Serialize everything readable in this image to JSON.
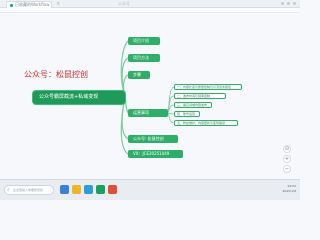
{
  "window": {
    "tab_title": "已收藏的Workflow",
    "tab_close": "×",
    "title": "公众号"
  },
  "mindmap": {
    "watermark": "公众号：松鼠控创",
    "root": "公众号霸屏截流+私域变现",
    "branches": [
      {
        "label": "项目介绍"
      },
      {
        "label": "项目方法"
      },
      {
        "label": "步骤"
      },
      {
        "label": "运营事项",
        "leaves": [
          "一、内容长度与质量控制与引流话术把控",
          "二、发布时间与频率控制",
          "三、垂直领域内容发布",
          "四、账号运营",
          "五、粉丝维护，内容更新与变现路径"
        ]
      },
      {
        "label": "公众号: 松鼠控创"
      },
      {
        "label": "VX：JCE20251049"
      }
    ]
  },
  "zoom_controls": [
    "+",
    "−",
    "⊙"
  ],
  "taskbar": {
    "search_placeholder": "在这里输入你要搜索的",
    "tray_time": "14:52",
    "tray_date": "2025/1/8"
  },
  "colors": {
    "node": "#2fae6a",
    "root": "#1f9a5a",
    "link": "#7cc9a1",
    "watermark": "#cc2d2d"
  }
}
